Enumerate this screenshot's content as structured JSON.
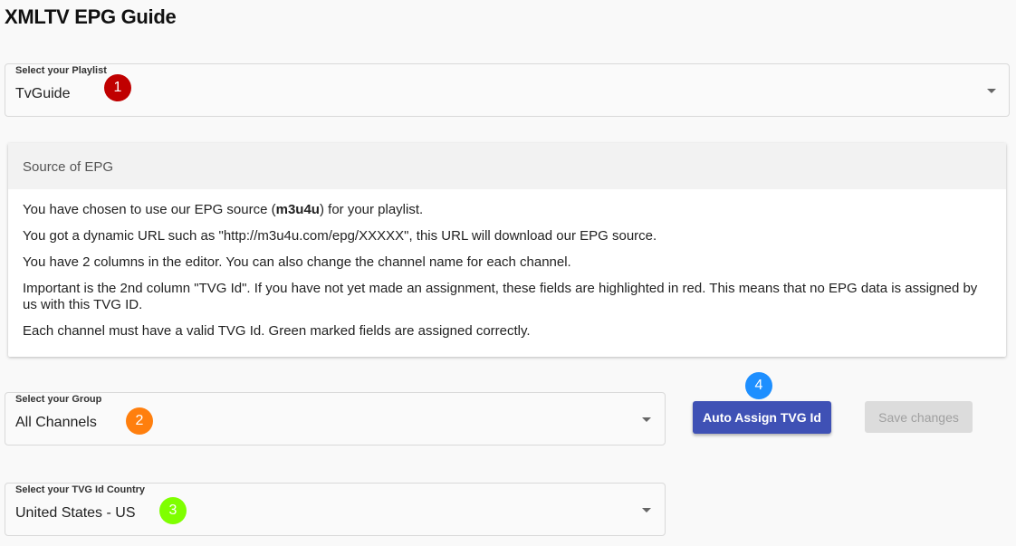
{
  "page": {
    "title": "XMLTV EPG Guide"
  },
  "playlist_select": {
    "label": "Select your Playlist",
    "value": "TvGuide",
    "badge": "1"
  },
  "epg_card": {
    "header": "Source of EPG",
    "line1_prefix": "You have chosen to use our EPG source (",
    "line1_bold": "m3u4u",
    "line1_suffix": ") for your playlist.",
    "line2": "You got a dynamic URL such as \"http://m3u4u.com/epg/XXXXX\", this URL will download our EPG source.",
    "line3": "You have 2 columns in the editor. You can also change the channel name for each channel.",
    "line4": "Important is the 2nd column \"TVG Id\". If you have not yet made an assignment, these fields are highlighted in red. This means that no EPG data is assigned by us with this TVG ID.",
    "line5": "Each channel must have a valid TVG Id. Green marked fields are assigned correctly."
  },
  "group_select": {
    "label": "Select your Group",
    "value": "All Channels",
    "badge": "2"
  },
  "country_select": {
    "label": "Select your TVG Id Country",
    "value": "United States - US",
    "badge": "3"
  },
  "actions": {
    "auto_assign_label": "Auto Assign TVG Id",
    "auto_assign_badge": "4",
    "save_label": "Save changes"
  },
  "colors": {
    "primary_button": "#3f51b5",
    "badge_1": "#c00000",
    "badge_2": "#ff7f0e",
    "badge_3": "#7fff00",
    "badge_4": "#1e8fff"
  }
}
